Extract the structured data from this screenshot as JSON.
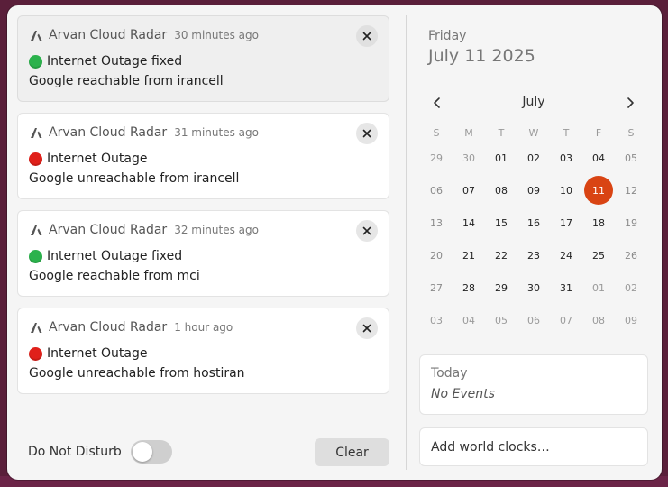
{
  "colors": {
    "panel_bg": "#f5f5f5",
    "today_accent": "#d94413",
    "status_ok": "#2bb24c",
    "status_down": "#e0201a"
  },
  "notifications": [
    {
      "app": "Arvan Cloud Radar",
      "time": "30 minutes ago",
      "status": "green",
      "title": "Internet Outage fixed",
      "body": "Google reachable from irancell"
    },
    {
      "app": "Arvan Cloud Radar",
      "time": "31 minutes ago",
      "status": "red",
      "title": "Internet Outage",
      "body": "Google unreachable from irancell"
    },
    {
      "app": "Arvan Cloud Radar",
      "time": "32 minutes ago",
      "status": "green",
      "title": "Internet Outage fixed",
      "body": "Google reachable from mci"
    },
    {
      "app": "Arvan Cloud Radar",
      "time": "1 hour ago",
      "status": "red",
      "title": "Internet Outage",
      "body": "Google unreachable from hostiran"
    }
  ],
  "icons": {
    "app": "arvan-cloud-logo-icon",
    "close": "close-icon",
    "prev": "chevron-left-icon",
    "next": "chevron-right-icon",
    "status_ok": "green-circle-icon",
    "status_down": "red-circle-icon"
  },
  "footer": {
    "dnd_label": "Do Not Disturb",
    "dnd_on": false,
    "clear_label": "Clear"
  },
  "calendar": {
    "day_name": "Friday",
    "full_date": "July 11 2025",
    "month": "July",
    "weekdays": [
      "S",
      "M",
      "T",
      "W",
      "T",
      "F",
      "S"
    ],
    "today": "11",
    "days": [
      "29",
      "30",
      "01",
      "02",
      "03",
      "04",
      "05",
      "06",
      "07",
      "08",
      "09",
      "10",
      "11",
      "12",
      "13",
      "14",
      "15",
      "16",
      "17",
      "18",
      "19",
      "20",
      "21",
      "22",
      "23",
      "24",
      "25",
      "26",
      "27",
      "28",
      "29",
      "30",
      "31",
      "01",
      "02",
      "03",
      "04",
      "05",
      "06",
      "07",
      "08",
      "09"
    ],
    "current_month_range": [
      2,
      32
    ]
  },
  "events": {
    "title": "Today",
    "empty_text": "No Events"
  },
  "world_clocks": {
    "label": "Add world clocks…"
  }
}
